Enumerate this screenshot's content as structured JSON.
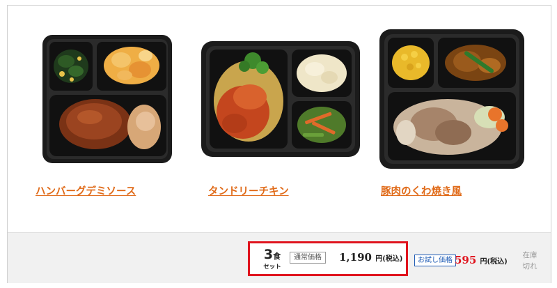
{
  "products": [
    {
      "name": "ハンバーグデミソース",
      "dish": "hamburg-demi-sauce"
    },
    {
      "name": "タンドリーチキン",
      "dish": "tandoori-chicken"
    },
    {
      "name": "豚肉のくわ焼き風",
      "dish": "pork-kuwayaki"
    }
  ],
  "purchase": {
    "quantity_number": "3",
    "quantity_unit": "食",
    "quantity_set": "セット",
    "regular_tag": "通常価格",
    "regular_price": "1,190",
    "regular_suffix": "円(税込)",
    "trial_tag": "お試し価格",
    "trial_price": "595",
    "trial_suffix": "円(税込)",
    "stock_status": "在庫切れ"
  },
  "colors": {
    "link": "#e06a18",
    "highlight_border": "#e0141e",
    "trial_price": "#e0141e",
    "trial_tag": "#1e5bb5",
    "stock_text": "#999999"
  }
}
